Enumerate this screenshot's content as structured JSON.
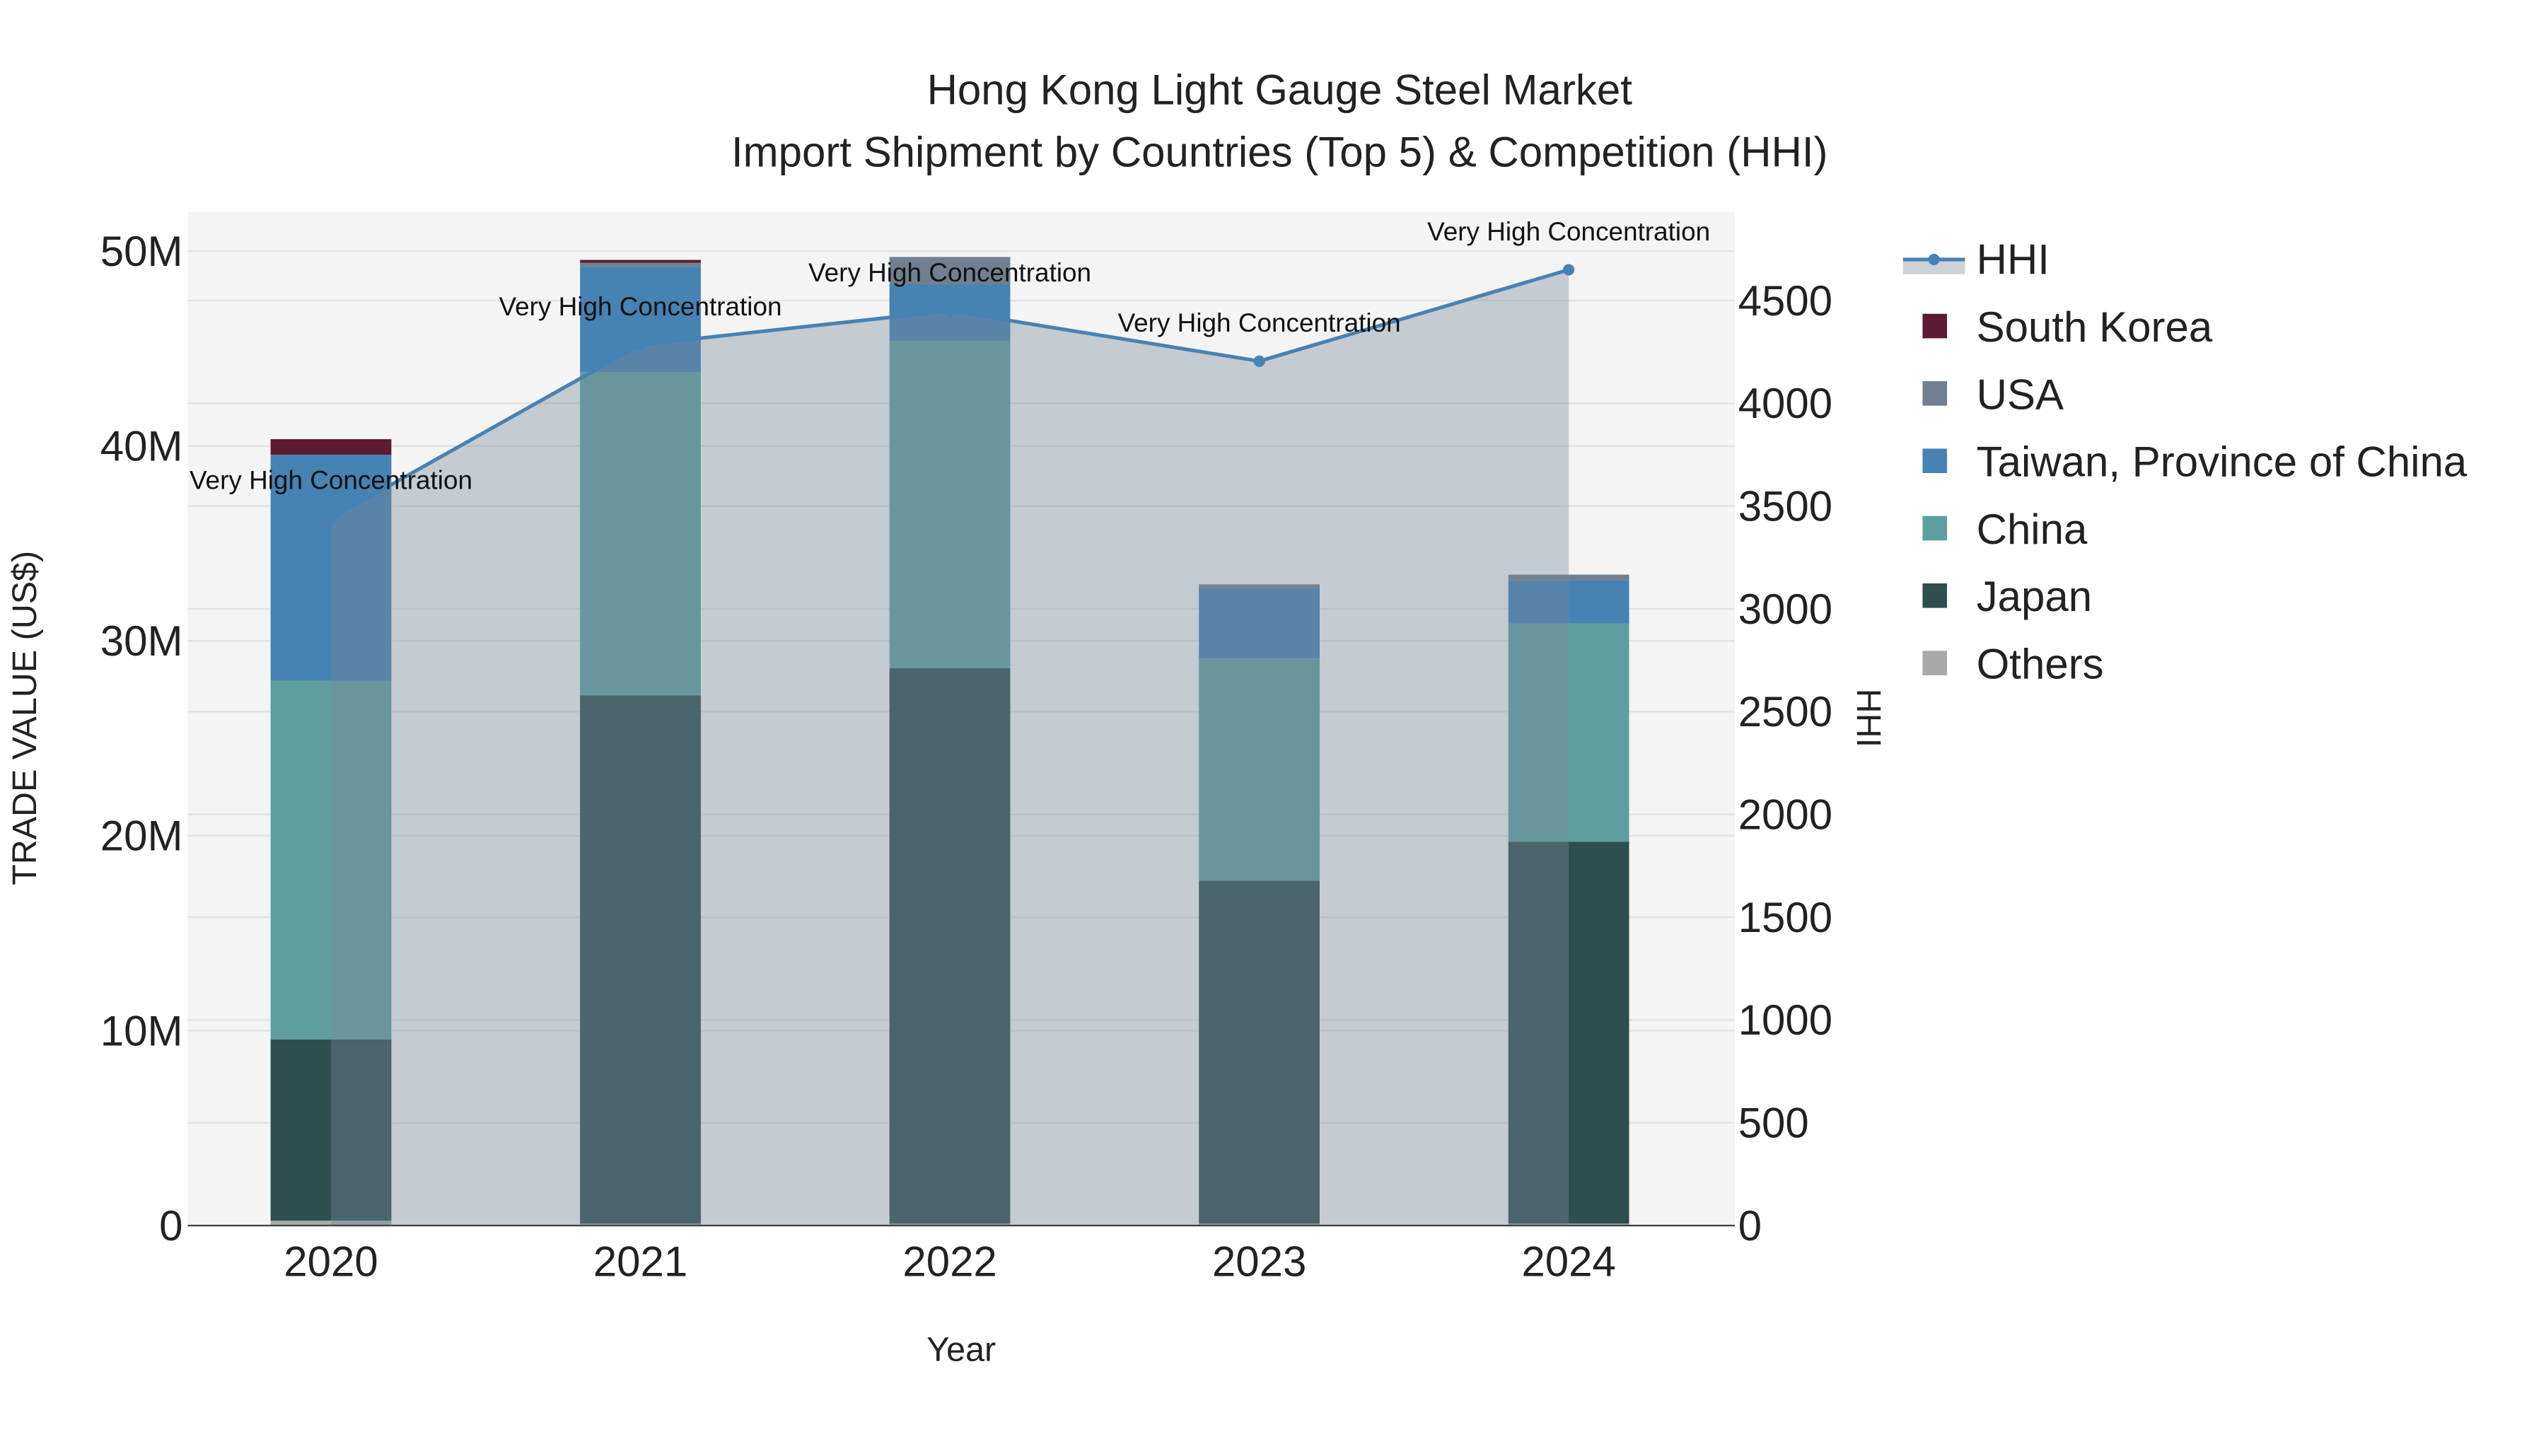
{
  "chart_data": {
    "type": "bar",
    "barmode": "stack",
    "title": "Hong Kong Light Gauge Steel Market",
    "subtitle": "Import Shipment by Countries (Top 5) & Competition (HHI)",
    "xlabel": "Year",
    "ylabel": "TRADE VALUE (US$)",
    "y2label": "HHI",
    "categories": [
      "2020",
      "2021",
      "2022",
      "2023",
      "2024"
    ],
    "ylim": [
      0,
      52000000
    ],
    "y2lim": [
      0,
      4930
    ],
    "yticks": [
      0,
      10000000,
      20000000,
      30000000,
      40000000,
      50000000
    ],
    "ytick_labels": [
      "0",
      "10M",
      "20M",
      "30M",
      "40M",
      "50M"
    ],
    "y2ticks": [
      0,
      500,
      1000,
      1500,
      2000,
      2500,
      3000,
      3500,
      4000,
      4500
    ],
    "y2tick_labels": [
      "0",
      "500",
      "1000",
      "1500",
      "2000",
      "2500",
      "3000",
      "3500",
      "4000",
      "4500"
    ],
    "grid": true,
    "legend_position": "right",
    "series": [
      {
        "name": "Others",
        "color": "#a9a9a9",
        "values": [
          250000,
          100000,
          100000,
          100000,
          100000
        ]
      },
      {
        "name": "Japan",
        "color": "#2f4f4f",
        "values": [
          9300000,
          27100000,
          28500000,
          17600000,
          19600000
        ]
      },
      {
        "name": "China",
        "color": "#5f9ea0",
        "values": [
          18400000,
          16600000,
          16800000,
          11400000,
          11200000
        ]
      },
      {
        "name": "Taiwan, Province of China",
        "color": "#4682b4",
        "values": [
          11600000,
          5400000,
          2900000,
          3600000,
          2200000
        ]
      },
      {
        "name": "USA",
        "color": "#708090",
        "values": [
          0,
          200000,
          1400000,
          200000,
          300000
        ]
      },
      {
        "name": "South Korea",
        "color": "#5c1a33",
        "values": [
          800000,
          150000,
          0,
          0,
          0
        ]
      }
    ],
    "line": {
      "name": "HHI",
      "color": "#4682b4",
      "values": [
        3440,
        4285,
        4450,
        4205,
        4650
      ],
      "annotations": [
        "Very High Concentration",
        "Very High Concentration",
        "Very High Concentration",
        "Very High Concentration",
        "Very High Concentration"
      ]
    },
    "legend_order": [
      "HHI",
      "South Korea",
      "USA",
      "Taiwan, Province of China",
      "China",
      "Japan",
      "Others"
    ]
  }
}
